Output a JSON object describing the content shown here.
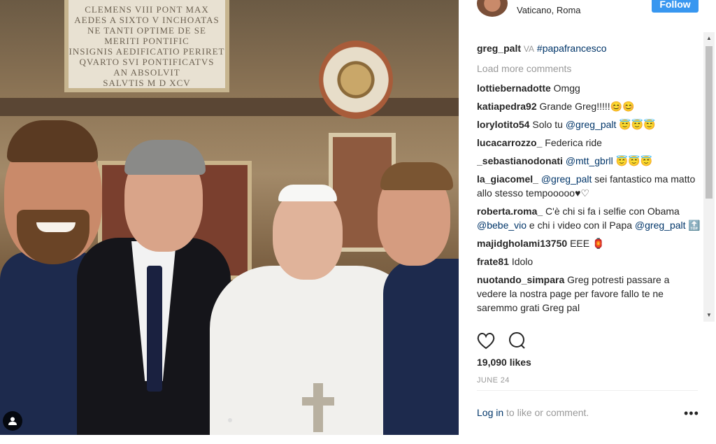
{
  "photo": {
    "plaque_lines": [
      "CLEMENS VIII PONT MAX",
      "AEDES A SIXTO V INCHOATAS",
      "NE TANTI OPTIME DE SE",
      "MERITI PONTIFIC",
      "INSIGNIS AEDIFICATIO PERIRET",
      "QVARTO SVI PONTIFICATVS",
      "AN ABSOLVIT",
      "SALVTIS M D XCV"
    ]
  },
  "header": {
    "location": "Vaticano, Roma",
    "follow_label": "Follow"
  },
  "caption": {
    "username": "greg_palt",
    "via": "VA",
    "hashtag": "#papafrancesco"
  },
  "load_more": "Load more comments",
  "comments": [
    {
      "user": "lottiebernadotte",
      "text": "Omgg"
    },
    {
      "user": "katiapedra92",
      "text": "Grande Greg!!!!!😊😊"
    },
    {
      "user": "lorylotito54",
      "pre": "Solo tu ",
      "mention": "@greg_palt",
      "post": " 😇😇😇"
    },
    {
      "user": "lucacarrozzo_",
      "text": "Federica ride"
    },
    {
      "user": "_sebastianodonati",
      "mention": "@mtt_gbrll",
      "post": " 😇😇😇"
    },
    {
      "user": "la_giacomel_",
      "mention": "@greg_palt",
      "post": " sei fantastico ma matto allo stesso tempooooo♥♡"
    },
    {
      "user": "roberta.roma_",
      "pre": "C'è chi si fa i selfie con Obama ",
      "mention": "@bebe_vio",
      "post": " e chi i video con il Papa ",
      "mention2": "@greg_palt",
      "post2": " 🔝"
    },
    {
      "user": "majidgholami13750",
      "text": "EEE 🏮"
    },
    {
      "user": "frate81",
      "text": "Idolo"
    },
    {
      "user": "nuotando_simpara",
      "text": "Greg potresti passare a vedere la nostra page per favore fallo te ne saremmo grati Greg pal"
    }
  ],
  "likes": "19,090 likes",
  "date": "JUNE 24",
  "login": {
    "link": "Log in",
    "text": " to like or comment."
  },
  "more_label": "•••",
  "icons": {
    "like": "heart-icon",
    "comment": "comment-icon",
    "more": "more-options-icon",
    "user_tag": "user-tag-icon"
  }
}
